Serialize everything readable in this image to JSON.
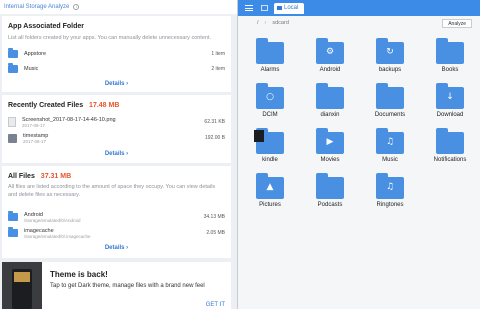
{
  "left": {
    "header_title": "Internal Storage Analyze",
    "associated": {
      "title": "App Associated Folder",
      "desc": "List all folders created by your apps. You can manually delete unnecessary content.",
      "rows": [
        {
          "name": "Appstore",
          "meta": "1 item"
        },
        {
          "name": "Music",
          "meta": "2 item"
        }
      ],
      "details": "Details"
    },
    "recent": {
      "title": "Recently Created Files",
      "size": "17.48 MB",
      "rows": [
        {
          "name": "Screenshot_2017-08-17-14-46-10.png",
          "sub": "2017-08-17",
          "meta": "62.31 KB"
        },
        {
          "name": "timestamp",
          "sub": "2017-08-17",
          "meta": "192.00 B"
        }
      ],
      "details": "Details"
    },
    "allfiles": {
      "title": "All Files",
      "size": "37.31 MB",
      "desc": "All files are listed according to the amount of space they occupy. You can view details and delete files as necessary.",
      "rows": [
        {
          "name": "Android",
          "sub": "/storage/emulated/0/Android",
          "meta": "34.13 MB"
        },
        {
          "name": "imagecache",
          "sub": "/storage/emulated/0/.imagecache",
          "meta": "2.05 MB"
        }
      ],
      "details": "Details"
    },
    "theme": {
      "title": "Theme is back!",
      "subtitle": "Tap to get Dark theme, manage files with a brand new feel",
      "action": "GET IT"
    }
  },
  "right": {
    "tab_label": "Local",
    "path": [
      "/",
      "sdcard"
    ],
    "analyze_label": "Analyze",
    "folders": [
      {
        "name": "Alarms",
        "glyph": ""
      },
      {
        "name": "Android",
        "glyph": "⚙"
      },
      {
        "name": "backups",
        "glyph": "↻"
      },
      {
        "name": "Books",
        "glyph": ""
      },
      {
        "name": "DCIM",
        "glyph": "○"
      },
      {
        "name": "dianxin",
        "glyph": ""
      },
      {
        "name": "Documents",
        "glyph": ""
      },
      {
        "name": "Download",
        "glyph": "↓"
      },
      {
        "name": "kindle",
        "glyph": ""
      },
      {
        "name": "Movies",
        "glyph": "▶"
      },
      {
        "name": "Music",
        "glyph": "♫"
      },
      {
        "name": "Notifications",
        "glyph": ""
      },
      {
        "name": "Pictures",
        "glyph": "▲"
      },
      {
        "name": "Podcasts",
        "glyph": ""
      },
      {
        "name": "Ringtones",
        "glyph": "♫"
      }
    ]
  }
}
